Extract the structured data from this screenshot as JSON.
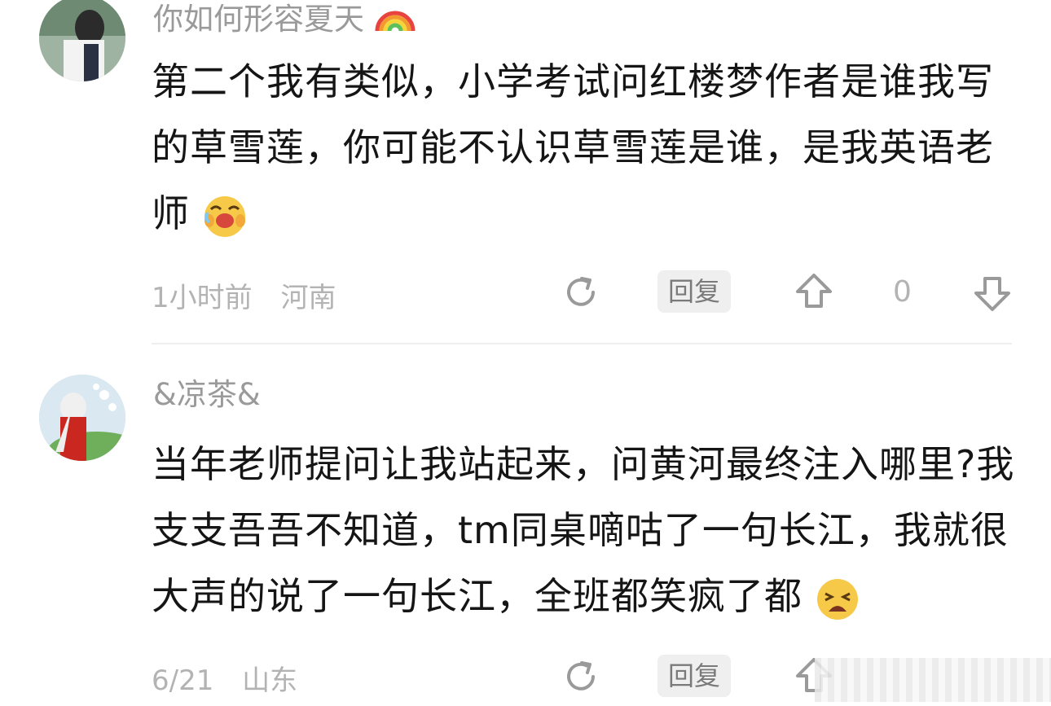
{
  "comments": [
    {
      "username": "你如何形容夏天",
      "username_emoji": "rainbow-emoji",
      "text": "第二个我有类似，小学考试问红楼梦作者是谁我写的草雪莲，你可能不认识草雪莲是谁，是我英语老师",
      "text_emoji": "laughing-crying-emoji",
      "time": "1小时前",
      "location": "河南",
      "reply_label": "回复",
      "like_count": "0"
    },
    {
      "username": "&凉茶&",
      "text": "当年老师提问让我站起来，问黄河最终注入哪里?我支支吾吾不知道，tm同桌嘀咕了一句长江，我就很大声的说了一句长江，全班都笑疯了都",
      "text_emoji": "weary-face-emoji",
      "time": "6/21",
      "location": "山东",
      "reply_label": "回复"
    }
  ],
  "colors": {
    "text": "#151515",
    "meta": "#b3b3b3",
    "reply_bg": "#efefef"
  }
}
